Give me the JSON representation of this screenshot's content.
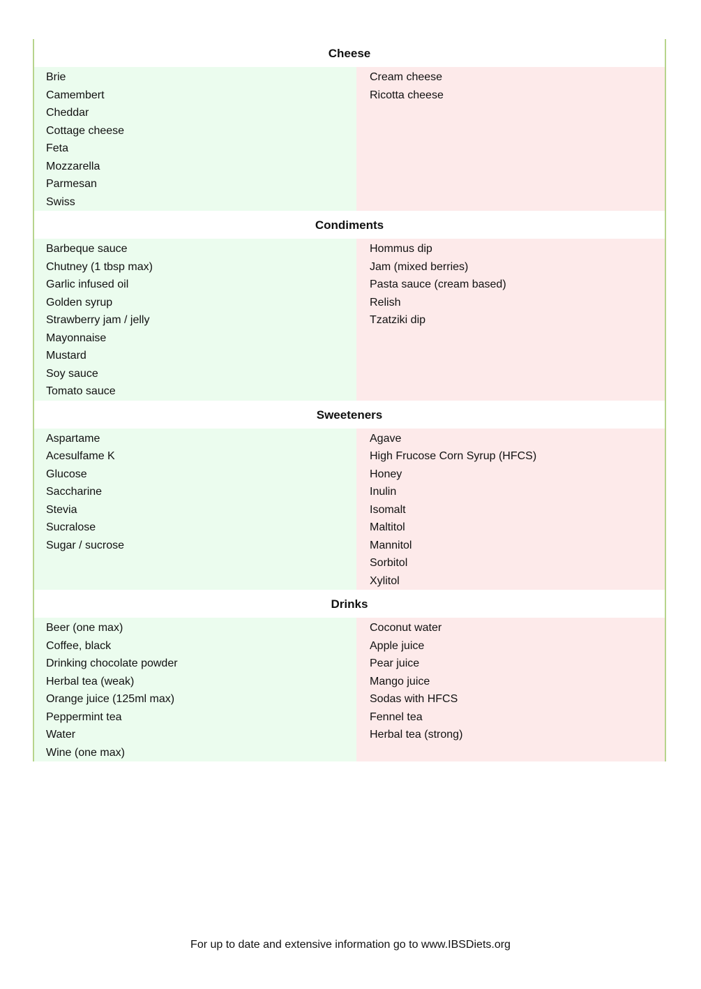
{
  "colors": {
    "safe_bg": "#ebfcee",
    "avoid_bg": "#fdeaea",
    "border": "#b7d48c"
  },
  "sections": [
    {
      "title": "Cheese",
      "left": [
        "Brie",
        "Camembert",
        "Cheddar",
        "Cottage cheese",
        "Feta",
        "Mozzarella",
        "Parmesan",
        "Swiss"
      ],
      "right": [
        "Cream cheese",
        "Ricotta cheese"
      ]
    },
    {
      "title": "Condiments",
      "left": [
        "Barbeque sauce",
        "Chutney (1 tbsp max)",
        "Garlic infused oil",
        "Golden syrup",
        "Strawberry jam / jelly",
        "Mayonnaise",
        "Mustard",
        "Soy sauce",
        "Tomato sauce"
      ],
      "right": [
        "Hommus dip",
        "Jam (mixed berries)",
        "Pasta sauce (cream based)",
        "Relish",
        "Tzatziki dip"
      ]
    },
    {
      "title": "Sweeteners",
      "left": [
        "Aspartame",
        "Acesulfame K",
        "Glucose",
        "Saccharine",
        "Stevia",
        "Sucralose",
        "Sugar / sucrose"
      ],
      "right": [
        "Agave",
        "High Frucose Corn Syrup (HFCS)",
        "Honey",
        "Inulin",
        "Isomalt",
        "Maltitol",
        "Mannitol",
        "Sorbitol",
        "Xylitol"
      ]
    },
    {
      "title": "Drinks",
      "left": [
        "Beer (one max)",
        "Coffee, black",
        "Drinking chocolate powder",
        "Herbal tea (weak)",
        "Orange juice (125ml max)",
        "Peppermint tea",
        "Water",
        "Wine (one max)"
      ],
      "right": [
        "Coconut water",
        "Apple juice",
        "Pear juice",
        "Mango juice",
        "Sodas with HFCS",
        "Fennel tea",
        "Herbal tea (strong)"
      ]
    }
  ],
  "footer": "For up to date and extensive information go to www.IBSDiets.org"
}
